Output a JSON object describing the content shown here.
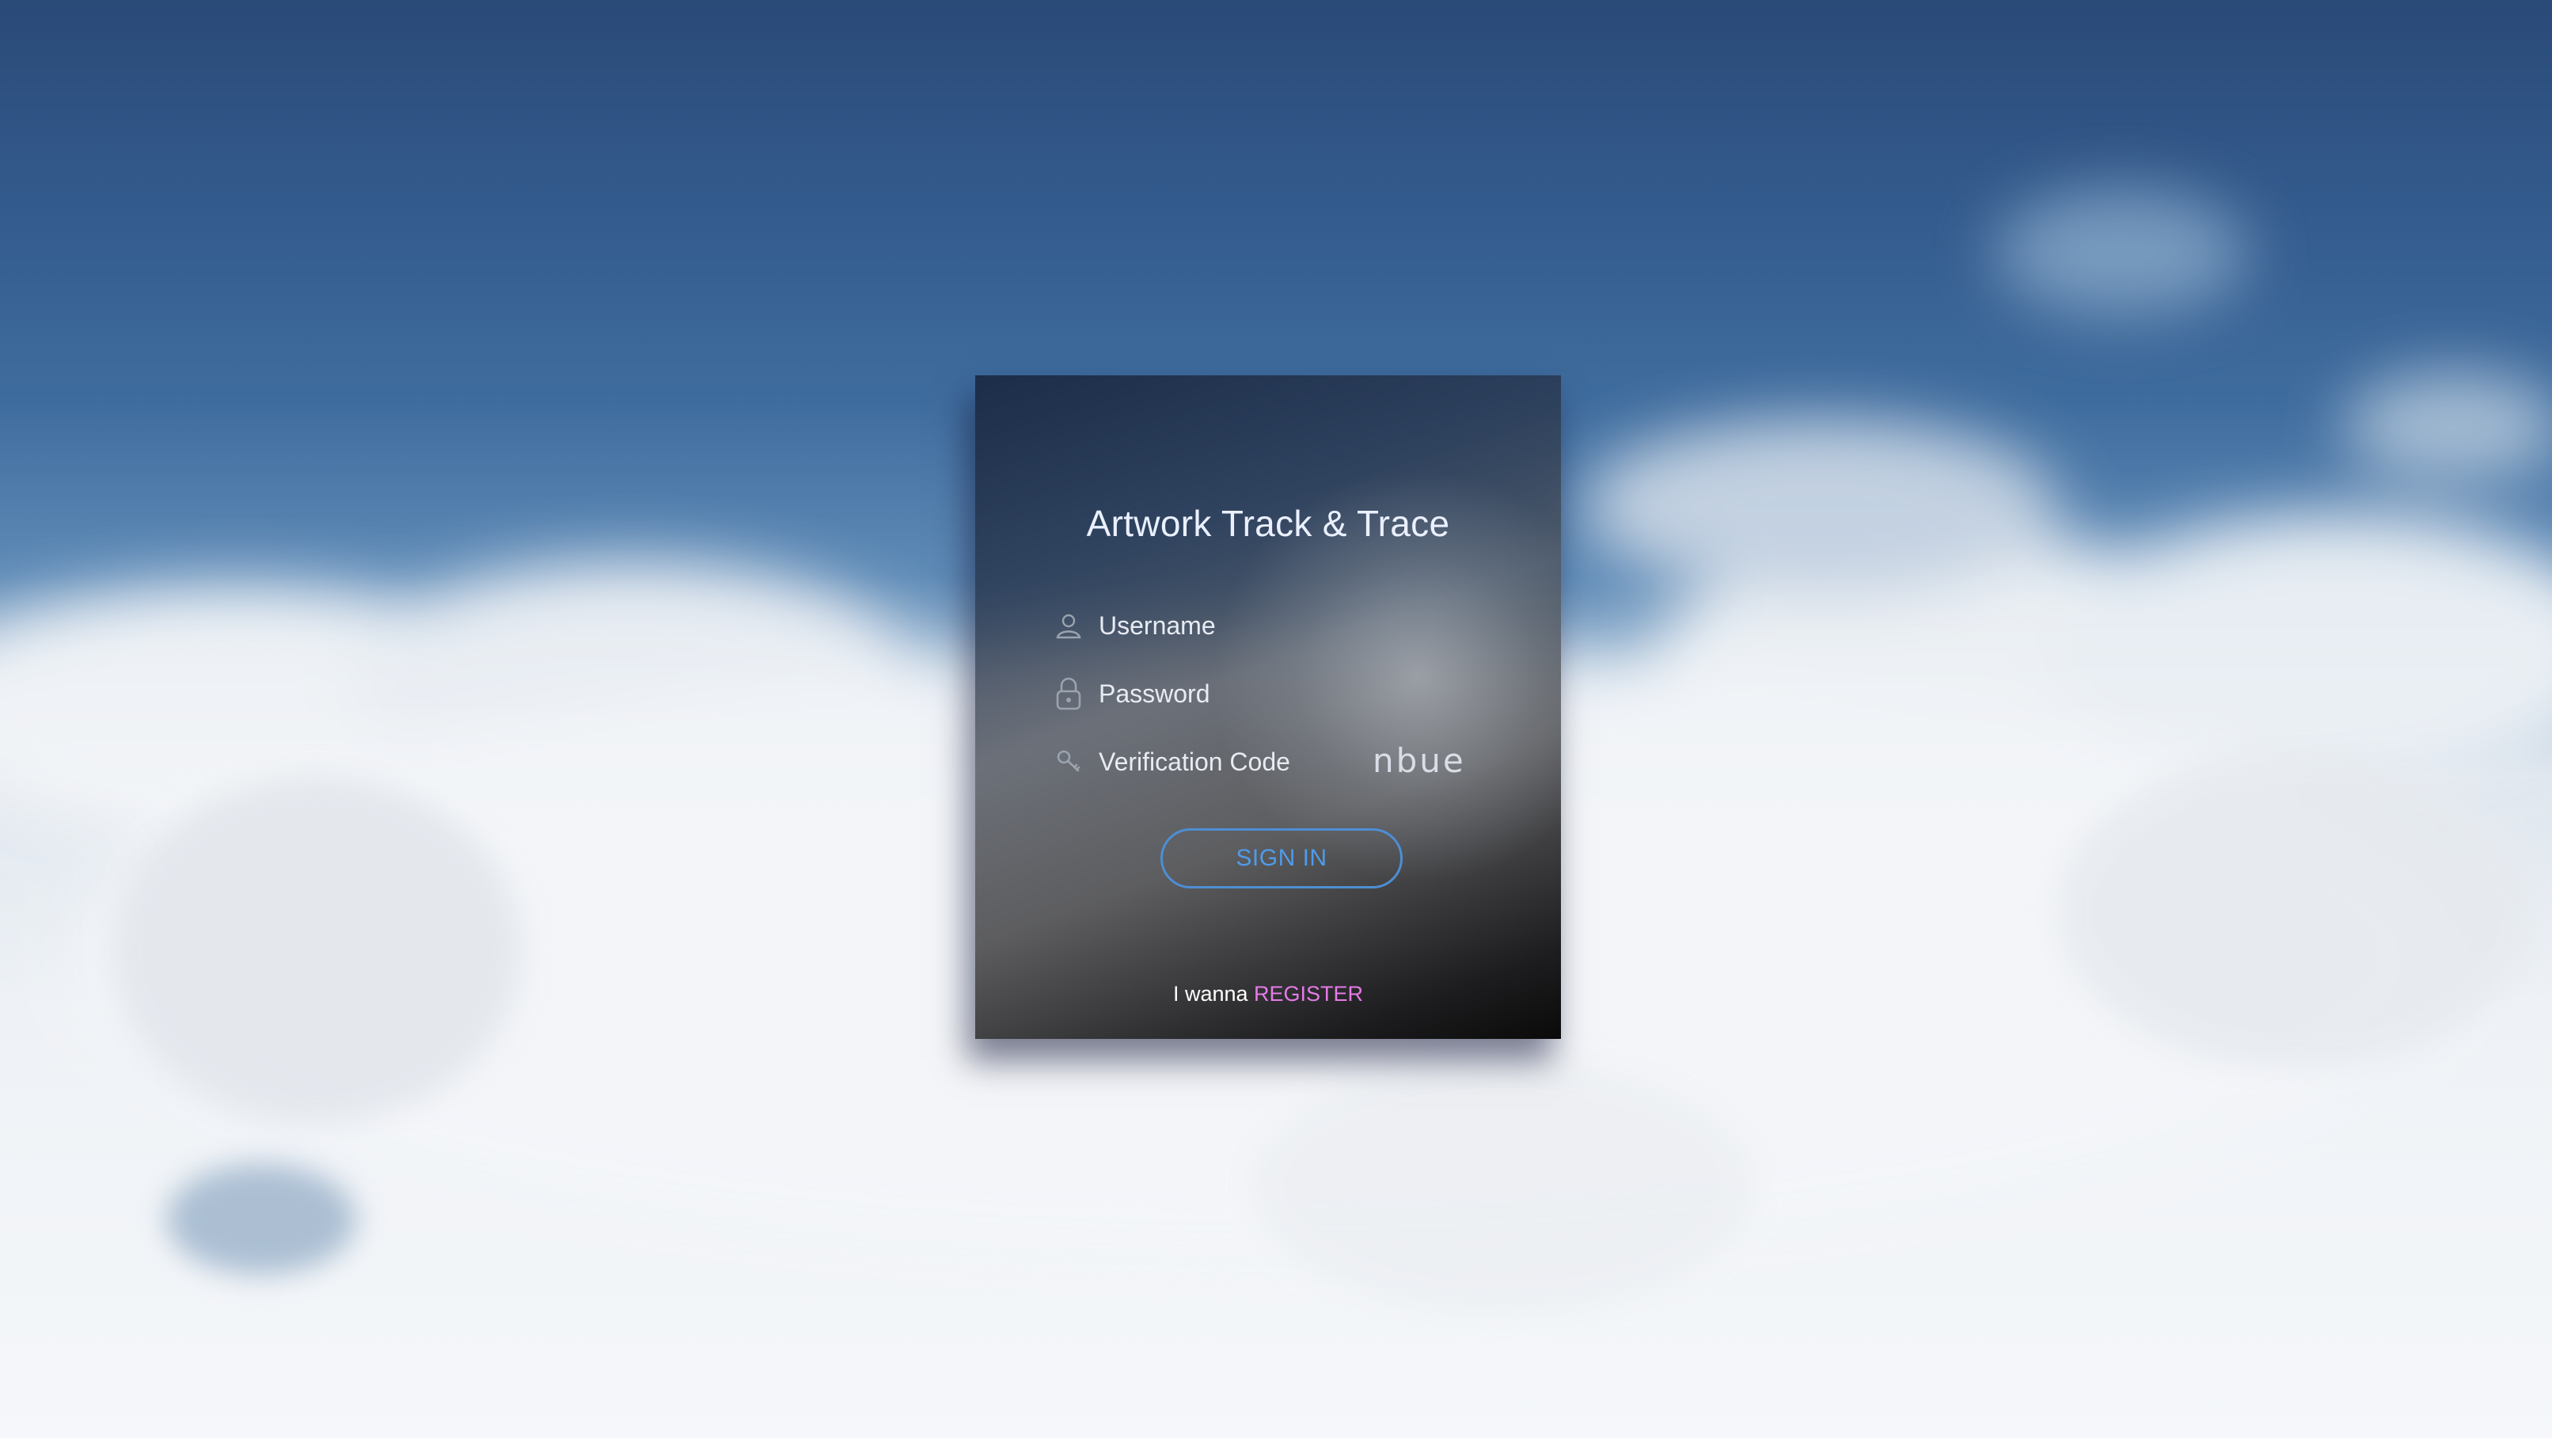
{
  "app": {
    "title": "Artwork Track & Trace"
  },
  "form": {
    "username": {
      "value": "",
      "placeholder": "Username",
      "icon": "user-icon"
    },
    "password": {
      "value": "",
      "placeholder": "Password",
      "icon": "lock-icon"
    },
    "verification": {
      "value": "",
      "placeholder": "Verification Code",
      "icon": "key-icon",
      "captcha_text": "nbue"
    },
    "sign_in_label": "SIGN IN",
    "register_prompt": "I wanna",
    "register_label": "REGISTER"
  },
  "colors": {
    "accent": "#4d8ed4",
    "register_link": "#e67be8",
    "title_text": "#eaf0ff"
  }
}
